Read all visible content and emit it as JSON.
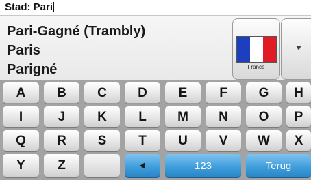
{
  "input": {
    "label": "Stad:",
    "value": "Pari"
  },
  "suggestions": [
    "Pari-Gagné (Trambly)",
    "Paris",
    "Parigné"
  ],
  "country": {
    "label": "France",
    "flag_colors": [
      "#1c3fbf",
      "#ffffff",
      "#e01b24"
    ]
  },
  "more_button": {
    "icon": "chevron-down-icon"
  },
  "keyboard": {
    "row1": [
      "A",
      "B",
      "C",
      "D",
      "E",
      "F",
      "G",
      "H"
    ],
    "row2": [
      "I",
      "J",
      "K",
      "L",
      "M",
      "N",
      "O",
      "P"
    ],
    "row3": [
      "Q",
      "R",
      "S",
      "T",
      "U",
      "V",
      "W",
      "X"
    ],
    "row4": {
      "y": "Y",
      "z": "Z",
      "backspace_icon": "backspace-icon",
      "numbers": "123",
      "back": "Terug"
    }
  },
  "colors": {
    "keyboard_bg": "#a3a3a3",
    "accent_blue": "#3f9fdc"
  }
}
